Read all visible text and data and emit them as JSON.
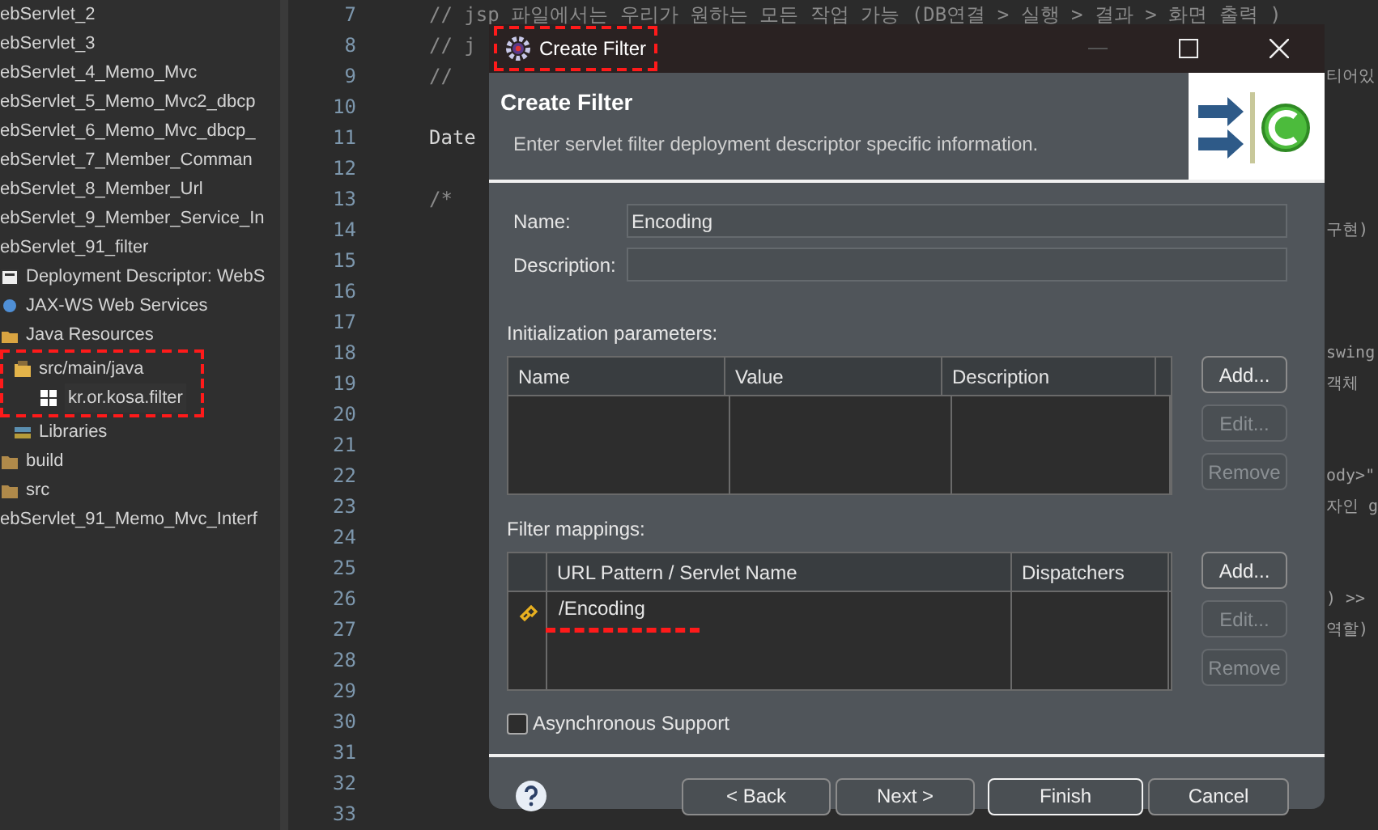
{
  "sidebar": {
    "items": [
      {
        "label": "ebServlet_2"
      },
      {
        "label": "ebServlet_3"
      },
      {
        "label": "ebServlet_4_Memo_Mvc"
      },
      {
        "label": "ebServlet_5_Memo_Mvc2_dbcp"
      },
      {
        "label": "ebServlet_6_Memo_Mvc_dbcp_"
      },
      {
        "label": "ebServlet_7_Member_Comman"
      },
      {
        "label": "ebServlet_8_Member_Url"
      },
      {
        "label": "ebServlet_9_Member_Service_In"
      },
      {
        "label": "ebServlet_91_filter",
        "children": [
          {
            "label": "Deployment Descriptor: WebS",
            "kind": "descriptor"
          },
          {
            "label": "JAX-WS Web Services",
            "kind": "services"
          },
          {
            "label": "Java Resources",
            "kind": "resources",
            "children": [
              {
                "label": "src/main/java",
                "kind": "source-folder",
                "highlighted": true,
                "children": [
                  {
                    "label": "kr.or.kosa.filter",
                    "kind": "package",
                    "selected": true
                  }
                ]
              },
              {
                "label": "Libraries",
                "kind": "libraries"
              }
            ]
          },
          {
            "label": "build",
            "kind": "folder"
          },
          {
            "label": "src",
            "kind": "folder"
          }
        ]
      },
      {
        "label": "ebServlet_91_Memo_Mvc_Interf"
      }
    ]
  },
  "editor": {
    "lines": [
      {
        "number": "7",
        "left": "// jsp 파일에서는 우리가 원하는 모든 작업 가능 (DB연결 > 실행 > 결과 > 화면 출력 )",
        "kind": "comment"
      },
      {
        "number": "8",
        "left": "// j",
        "kind": "comment"
      },
      {
        "number": "9",
        "left": "//",
        "kind": "comment",
        "right": "티어있"
      },
      {
        "number": "10"
      },
      {
        "number": "11",
        "left": "Date",
        "kind": "code"
      },
      {
        "number": "12"
      },
      {
        "number": "13",
        "left": "/*",
        "kind": "comment"
      },
      {
        "number": "14",
        "right": "구현)"
      },
      {
        "number": "15"
      },
      {
        "number": "16"
      },
      {
        "number": "17"
      },
      {
        "number": "18",
        "right": "swing"
      },
      {
        "number": "19",
        "right": "객체"
      },
      {
        "number": "20"
      },
      {
        "number": "21"
      },
      {
        "number": "22",
        "right": "ody>\""
      },
      {
        "number": "23",
        "right": "자인 g"
      },
      {
        "number": "24"
      },
      {
        "number": "25"
      },
      {
        "number": "26",
        "right": ") >>"
      },
      {
        "number": "27",
        "right": "역할)"
      },
      {
        "number": "28"
      },
      {
        "number": "29"
      },
      {
        "number": "30"
      },
      {
        "number": "31"
      },
      {
        "number": "32"
      },
      {
        "number": "33"
      }
    ]
  },
  "dialog": {
    "title": "Create Filter",
    "title_highlighted": true,
    "minimize_disabled": true,
    "heading": "Create Filter",
    "description": "Enter servlet filter deployment descriptor specific information.",
    "fields": [
      {
        "label": "Name:",
        "value": "Encoding"
      },
      {
        "label": "Description:"
      }
    ],
    "init_params": {
      "label": "Initialization parameters:",
      "columns": [
        "Name",
        "Value",
        "Description"
      ],
      "buttons": [
        {
          "label": "Add...",
          "disabled": false
        },
        {
          "label": "Edit...",
          "disabled": true
        },
        {
          "label": "Remove",
          "disabled": true
        }
      ]
    },
    "filter_mappings": {
      "label": "Filter mappings:",
      "columns": [
        "URL Pattern / Servlet Name",
        "Dispatchers"
      ],
      "rows": [
        {
          "pattern": "/Encoding",
          "underlined": true
        }
      ],
      "buttons": [
        {
          "label": "Add...",
          "disabled": false
        },
        {
          "label": "Edit...",
          "disabled": true
        },
        {
          "label": "Remove",
          "disabled": true
        }
      ]
    },
    "async": {
      "label": "Asynchronous Support",
      "checked": false
    },
    "footer_buttons": [
      {
        "label": "< Back",
        "default": false
      },
      {
        "label": "Next >",
        "default": false
      },
      {
        "label": "Finish",
        "default": true
      },
      {
        "label": "Cancel",
        "default": false
      }
    ]
  }
}
